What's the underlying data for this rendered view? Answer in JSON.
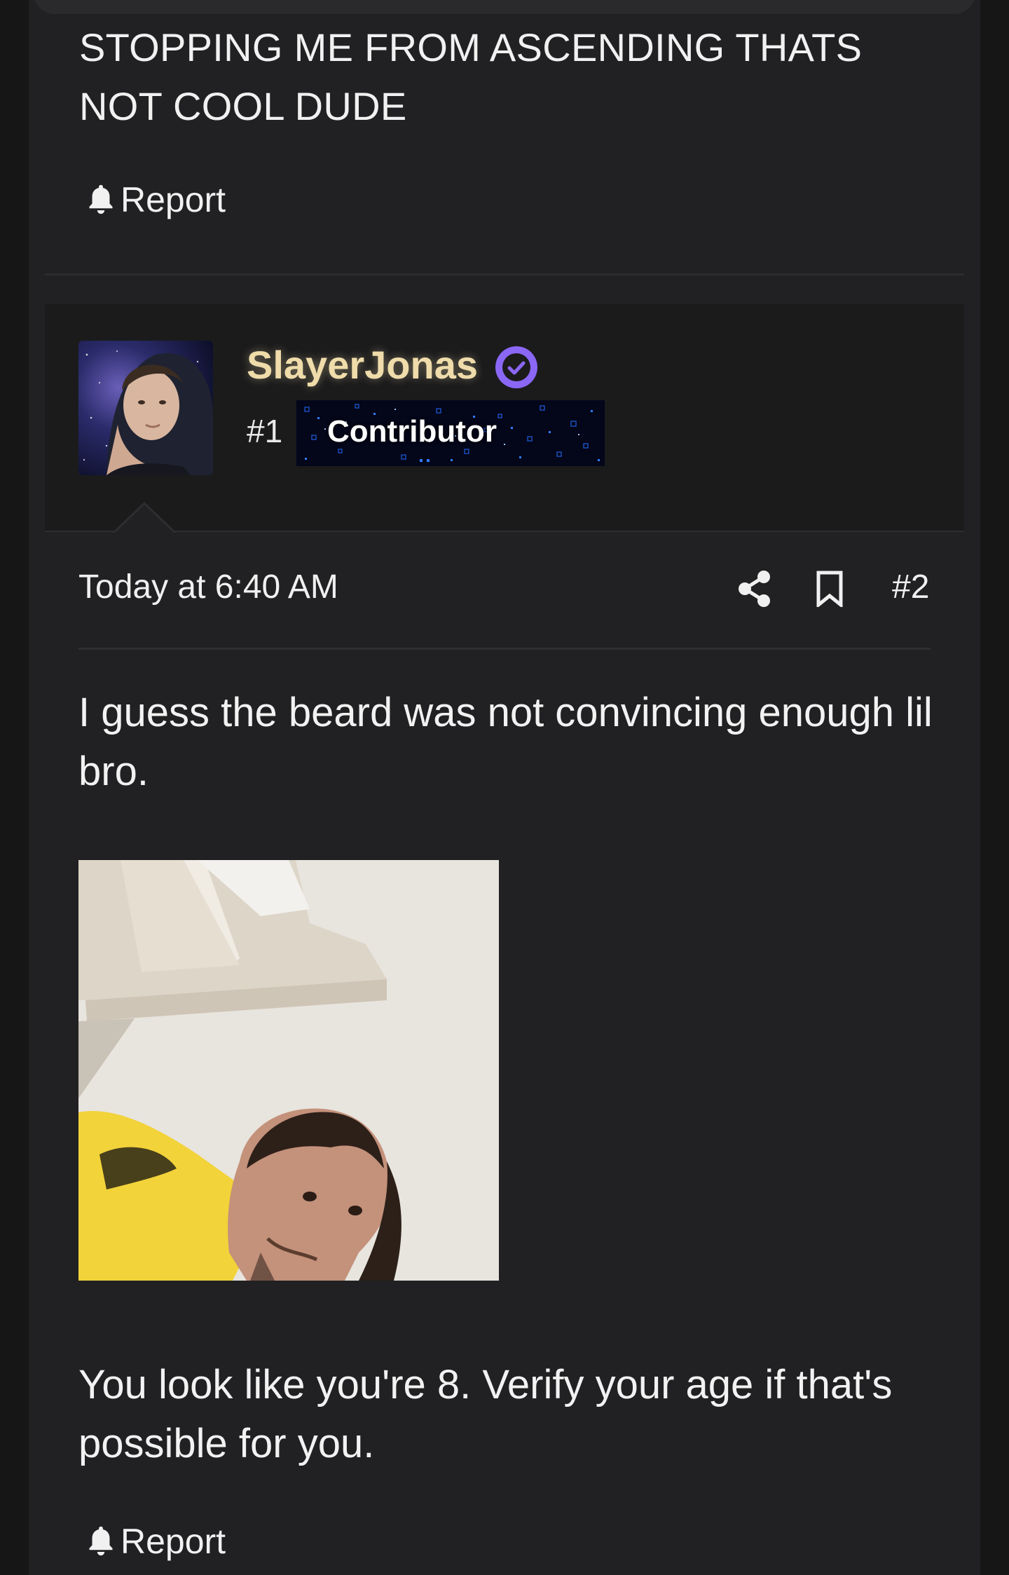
{
  "previous_post": {
    "text": "STOPPING ME FROM ASCENDING THATS NOT COOL DUDE",
    "report_label": "Report",
    "report_icon": "bell-icon"
  },
  "user": {
    "name": "SlayerJonas",
    "verified_icon": "verified-check-icon",
    "rank": "#1",
    "badge_label": "Contributor",
    "name_color": "#efdcaa",
    "verified_color": "#8b67f5"
  },
  "post": {
    "timestamp": "Today at 6:40 AM",
    "share_icon": "share-icon",
    "bookmark_icon": "bookmark-icon",
    "number": "#2",
    "paragraph_1": "I guess the beard was not convincing enough lil bro.",
    "paragraph_2": "You look like you're 8. Verify your age if that's possible for you.",
    "report_label": "Report",
    "report_icon": "bell-icon"
  },
  "colors": {
    "background": "#161616",
    "panel": "#212123",
    "user_block": "#1b1b1c",
    "text": "#f1f1f1"
  }
}
